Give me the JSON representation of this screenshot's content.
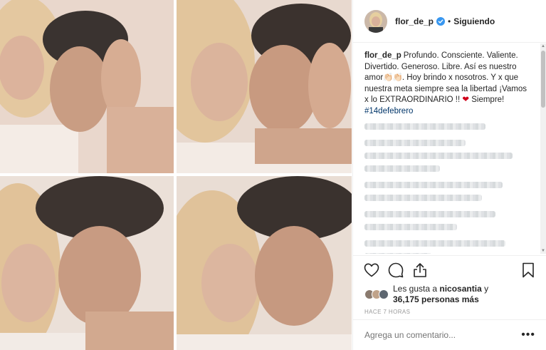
{
  "post": {
    "username": "flor_de_p",
    "separator": "•",
    "following_label": "Siguiendo",
    "caption_user": "flor_de_p",
    "caption_text": "Profundo. Consciente. Valiente. Divertido. Generoso. Libre. Así es nuestro amor",
    "caption_emoji": "👏🏻👏🏻",
    "caption_text_2": ". Hoy brindo x nosotros. Y x que nuestra meta siempre sea la libertad ¡Vamos x lo EXTRAORDINARIO !! ",
    "caption_heart": "❤",
    "caption_text_3": " Siempre! ",
    "hashtag": "#14defebrero",
    "likes_line_1_prefix": "Les gusta a ",
    "likes_user": "nicosantia",
    "likes_line_1_suffix": " y",
    "likes_count": "36,175 personas más",
    "time": "HACE 7 HORAS",
    "comment_placeholder": "Agrega un comentario...",
    "more_label": "•••"
  },
  "icons": {
    "verified": "verified-badge-icon",
    "like": "heart-outline-icon",
    "comment": "comment-bubble-icon",
    "share": "share-arrow-icon",
    "save": "bookmark-icon"
  },
  "colors": {
    "verified": "#3897f0",
    "heart": "#d0021b",
    "hashtag": "#003569",
    "muted": "#999999"
  }
}
